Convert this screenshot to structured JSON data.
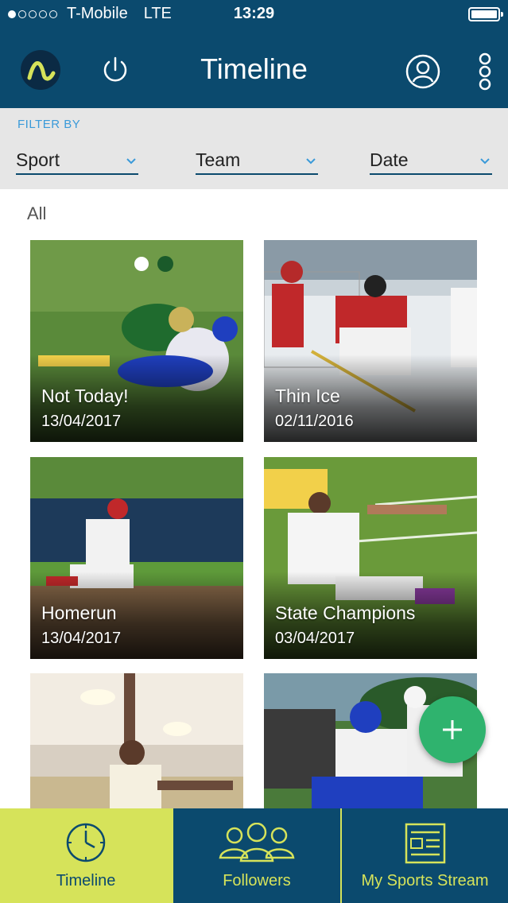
{
  "status_bar": {
    "carrier": "T-Mobile",
    "network": "LTE",
    "time": "13:29"
  },
  "header": {
    "title": "Timeline"
  },
  "filter": {
    "label": "FILTER BY",
    "dropdowns": [
      {
        "label": "Sport"
      },
      {
        "label": "Team"
      },
      {
        "label": "Date"
      }
    ]
  },
  "section": {
    "title": "All"
  },
  "cards": [
    {
      "title": "Not Today!",
      "date": "13/04/2017"
    },
    {
      "title": "Thin Ice",
      "date": "02/11/2016"
    },
    {
      "title": "Homerun",
      "date": "13/04/2017"
    },
    {
      "title": "State Champions",
      "date": "03/04/2017"
    },
    {
      "title": "",
      "date": ""
    },
    {
      "title": "",
      "date": ""
    }
  ],
  "tabs": [
    {
      "label": "Timeline",
      "icon": "clock-icon"
    },
    {
      "label": "Followers",
      "icon": "people-icon"
    },
    {
      "label": "My Sports Stream",
      "icon": "newspaper-icon"
    }
  ],
  "colors": {
    "primary": "#0b4a6e",
    "accent": "#d6e35a",
    "fab": "#2fb36e",
    "filter_label": "#3a9ad9"
  }
}
